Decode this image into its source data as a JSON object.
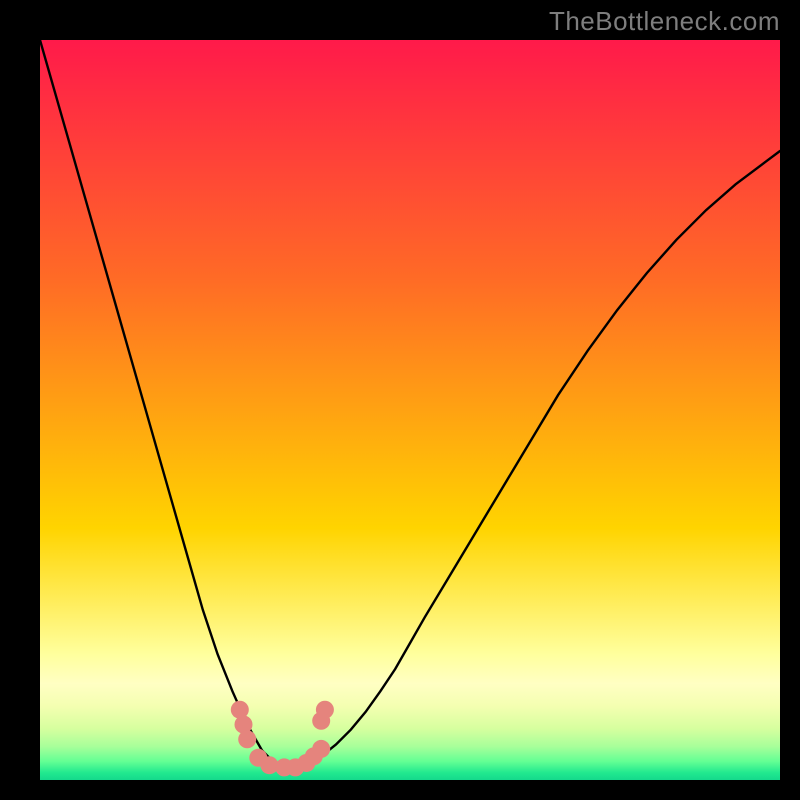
{
  "watermark": "TheBottleneck.com",
  "colors": {
    "black": "#000000",
    "curve": "#000000",
    "marker": "#e5847d",
    "top": "#ff1a4a",
    "mid_upper": "#ff6a26",
    "mid": "#ffd400",
    "band1": "#ffff9d",
    "band2": "#ffffc3",
    "band3": "#f4ffb1",
    "band4": "#d7ff9f",
    "band5": "#a7ff9a",
    "band6": "#63ff94",
    "band7": "#22e98f",
    "band8": "#14d98c"
  },
  "chart_data": {
    "type": "line",
    "title": "",
    "xlabel": "",
    "ylabel": "",
    "xlim": [
      0,
      100
    ],
    "ylim": [
      0,
      100
    ],
    "x": [
      0,
      2,
      4,
      6,
      8,
      10,
      12,
      14,
      16,
      18,
      20,
      22,
      24,
      26,
      28,
      30,
      31,
      32,
      33,
      34,
      35,
      36,
      38,
      40,
      42,
      44,
      46,
      48,
      50,
      52,
      55,
      58,
      61,
      64,
      67,
      70,
      74,
      78,
      82,
      86,
      90,
      94,
      98,
      100
    ],
    "values": [
      100,
      93,
      86,
      79,
      72,
      65,
      58,
      51,
      44,
      37,
      30,
      23,
      17,
      12,
      7.5,
      4,
      3,
      2.2,
      1.8,
      1.6,
      1.8,
      2.2,
      3.2,
      4.8,
      6.8,
      9.2,
      12,
      15,
      18.5,
      22,
      27,
      32,
      37,
      42,
      47,
      52,
      58,
      63.5,
      68.5,
      73,
      77,
      80.5,
      83.5,
      85
    ],
    "markers": [
      {
        "x": 27,
        "y": 9.5
      },
      {
        "x": 27.5,
        "y": 7.5
      },
      {
        "x": 28,
        "y": 5.5
      },
      {
        "x": 29.5,
        "y": 3
      },
      {
        "x": 31,
        "y": 2
      },
      {
        "x": 33,
        "y": 1.7
      },
      {
        "x": 34.5,
        "y": 1.7
      },
      {
        "x": 36,
        "y": 2.3
      },
      {
        "x": 37,
        "y": 3.2
      },
      {
        "x": 38,
        "y": 4.2
      },
      {
        "x": 38,
        "y": 8
      },
      {
        "x": 38.5,
        "y": 9.5
      }
    ]
  }
}
